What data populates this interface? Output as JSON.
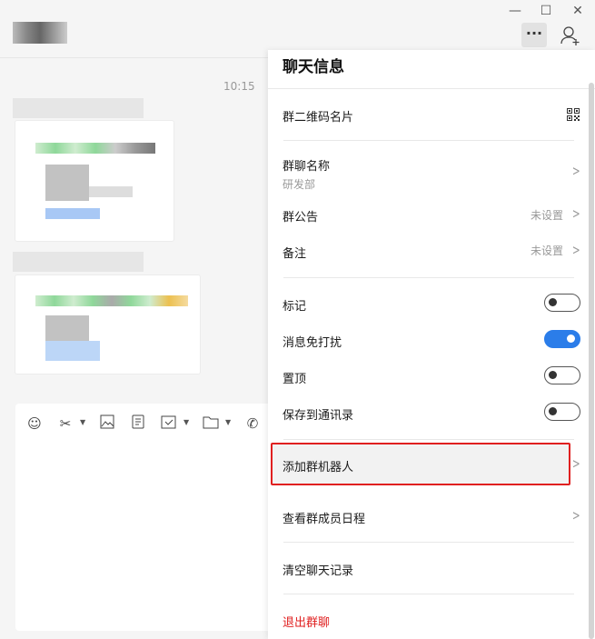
{
  "chat": {
    "timestamp": "10:15"
  },
  "window": {
    "more_label": "···",
    "minimize": "—",
    "maximize": "☐",
    "close": "✕"
  },
  "panel": {
    "title": "聊天信息",
    "qr_label": "群二维码名片",
    "group_name_label": "群聊名称",
    "group_name_value": "研发部",
    "announcement_label": "群公告",
    "announcement_value": "未设置",
    "remark_label": "备注",
    "remark_value": "未设置",
    "toggles": [
      {
        "label": "标记",
        "on": false
      },
      {
        "label": "消息免打扰",
        "on": true
      },
      {
        "label": "置顶",
        "on": false
      },
      {
        "label": "保存到通讯录",
        "on": false
      }
    ],
    "add_bot": "添加群机器人",
    "member_schedule": "查看群成员日程",
    "clear_history": "清空聊天记录",
    "leave_group": "退出群聊"
  },
  "colors": {
    "accent": "#2b7de9",
    "danger": "#e02020"
  }
}
